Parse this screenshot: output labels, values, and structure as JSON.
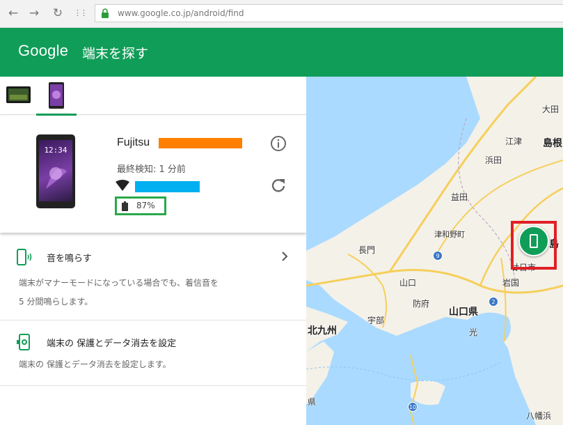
{
  "browser": {
    "back": "←",
    "forward": "→",
    "reload": "↻",
    "apps": "⋮⋮",
    "url": "www.google.co.jp/android/find"
  },
  "header": {
    "brand": "Google",
    "title": "端末を探す"
  },
  "device": {
    "name": "Fujitsu",
    "last_seen": "最終検知: 1 分前",
    "battery": "87%",
    "lock_time": "12:34"
  },
  "actions": {
    "ring": {
      "title": "音を鳴らす",
      "desc_line1": "端末がマナーモードになっている場合でも、着信音を",
      "desc_line2": "5 分間鳴らします。"
    },
    "secure": {
      "title": "端末の 保護とデータ消去を設定",
      "desc": "端末の 保護とデータ消去を設定します。"
    }
  },
  "map": {
    "labels": {
      "ohda": "大田",
      "goutsu": "江津",
      "shimane": "島根",
      "hamada": "浜田",
      "masuda": "益田",
      "tsuwano": "津和野町",
      "nagato": "長門",
      "yamaguchi": "山口",
      "hofu": "防府",
      "yamaguchi_pref": "山口県",
      "iwakuni": "岩国",
      "hatsukaichi": "廿日市",
      "ube": "宇部",
      "hikari": "光",
      "kitakyushu": "北九州",
      "ken": "県",
      "yahata": "八幡浜",
      "shima": "島"
    },
    "routes": {
      "r9": "9",
      "r2": "2",
      "r10": "10"
    },
    "colors": {
      "sea": "#aadaff",
      "land": "#f4f1e8",
      "marker": "#109d58",
      "highlight_box": "#e01f26"
    }
  }
}
